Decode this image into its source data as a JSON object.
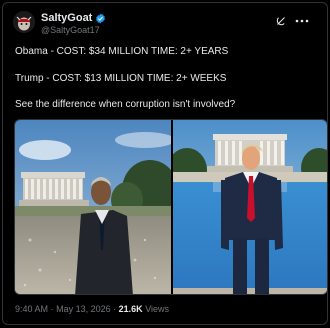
{
  "author": {
    "display_name": "SaltyGoat",
    "handle": "@SaltyGoat17",
    "verified_color": "#1d9bf0"
  },
  "icons": {
    "verified": "verified-badge-icon",
    "grok": "grok-icon",
    "more": "more-options-icon"
  },
  "post": {
    "line1": "Obama - COST: $34 MILLION TIME: 2+ YEARS",
    "line2": "Trump - COST: $13 MILLION TIME: 2+ WEEKS",
    "line3": "See the difference when corruption isn't involved?"
  },
  "meta": {
    "time": "9:40 AM",
    "separator": "·",
    "date": "May 13, 2026",
    "views_count": "21.6K",
    "views_label": "Views"
  },
  "colors": {
    "background": "#000000",
    "text": "#e7e9ea",
    "muted": "#71767b",
    "border": "#2f3336"
  }
}
